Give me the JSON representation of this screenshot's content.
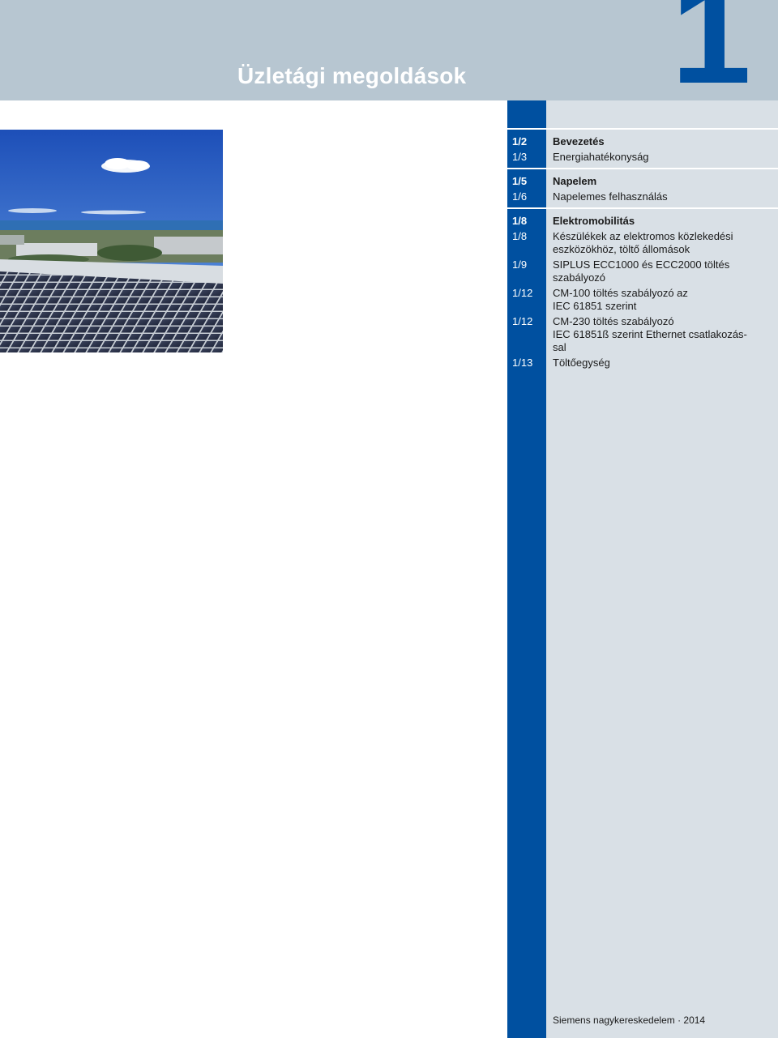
{
  "header": {
    "chapter_title": "Üzletági megoldások",
    "chapter_number": "1"
  },
  "photo": {
    "alt": "solar-panel-roof-photo"
  },
  "toc": {
    "groups": [
      {
        "items": [
          {
            "page": "1/2",
            "lines": [
              "Bevezetés"
            ],
            "heading": true
          },
          {
            "page": "1/3",
            "lines": [
              "Energiahatékonyság"
            ],
            "heading": false
          }
        ]
      },
      {
        "items": [
          {
            "page": "1/5",
            "lines": [
              "Napelem"
            ],
            "heading": true
          },
          {
            "page": "1/6",
            "lines": [
              "Napelemes felhasználás"
            ],
            "heading": false
          }
        ]
      },
      {
        "items": [
          {
            "page": "1/8",
            "lines": [
              "Elektromobilitás"
            ],
            "heading": true
          },
          {
            "page": "1/8",
            "lines": [
              "Készülékek az elektromos közlekedési",
              "eszközökhöz, töltő állomások"
            ],
            "heading": false
          },
          {
            "page": "1/9",
            "lines": [
              "SIPLUS ECC1000 és ECC2000 töltés",
              "szabályozó"
            ],
            "heading": false
          },
          {
            "page": "1/12",
            "lines": [
              "CM-100 töltés szabályozó az",
              "IEC 61851 szerint"
            ],
            "heading": false
          },
          {
            "page": "1/12",
            "lines": [
              "CM-230 töltés szabályozó",
              "IEC 61851ß szerint Ethernet csatlakozás-",
              "sal"
            ],
            "heading": false
          },
          {
            "page": "1/13",
            "lines": [
              "Töltőegység"
            ],
            "heading": false
          }
        ]
      }
    ]
  },
  "footer": {
    "text": "Siemens nagykereskedelem · 2014"
  }
}
